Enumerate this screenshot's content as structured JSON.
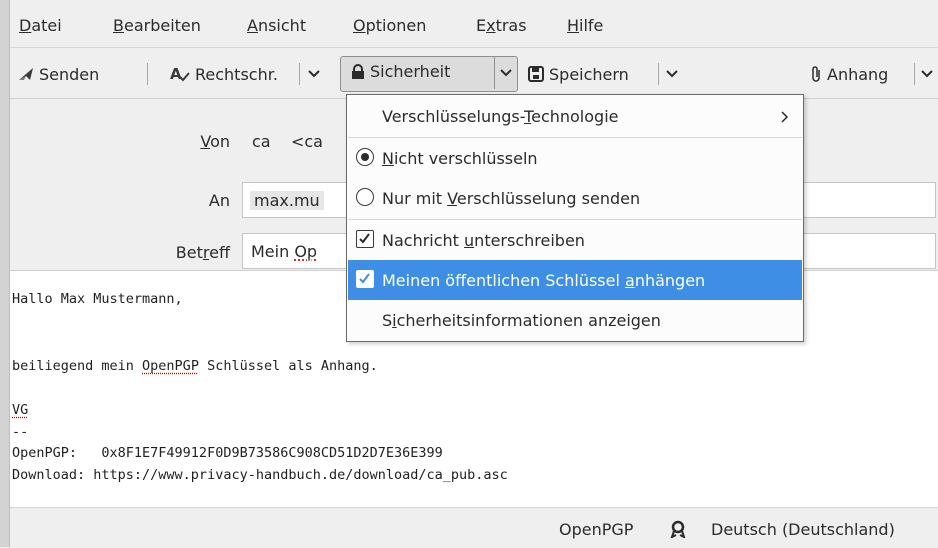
{
  "menubar": {
    "items": [
      {
        "pre": "",
        "u": "D",
        "post": "atei"
      },
      {
        "pre": "",
        "u": "B",
        "post": "earbeiten"
      },
      {
        "pre": "",
        "u": "A",
        "post": "nsicht"
      },
      {
        "pre": "",
        "u": "O",
        "post": "ptionen"
      },
      {
        "pre": "E",
        "u": "x",
        "post": "tras"
      },
      {
        "pre": "",
        "u": "H",
        "post": "ilfe"
      }
    ]
  },
  "toolbar": {
    "send_label": "Senden",
    "spell_label": "Rechtschr.",
    "security_label": "Sicherheit",
    "save_label": "Speichern",
    "attach_label": "Anhang"
  },
  "header": {
    "from_label": {
      "pre": "",
      "u": "V",
      "post": "on"
    },
    "from_value": "ca    <ca",
    "to_label": "An",
    "to_value": "max.mu",
    "subject_label": {
      "pre": "Bet",
      "u": "r",
      "post": "eff"
    },
    "subject_value_pre": "Mein ",
    "subject_value_spell": "Op"
  },
  "body": {
    "line1": "Hallo Max Mustermann,",
    "line2_pre": "beiliegend mein ",
    "line2_spell": "OpenPGP",
    "line2_post": " Schlüssel als Anhang.",
    "line3": "VG",
    "line4": "--",
    "line5": "OpenPGP:   0x8F1E7F49912F0D9B73586C908CD51D2D7E36E399",
    "line6": "Download: https://www.privacy-handbuch.de/download/ca_pub.asc"
  },
  "statusbar": {
    "openpgp": "OpenPGP",
    "language": "Deutsch (Deutschland)"
  },
  "dropdown": {
    "encryption_tech": {
      "pre": "Verschlüsselungs-",
      "u": "T",
      "post": "echnologie"
    },
    "no_encrypt": {
      "pre": "",
      "u": "N",
      "post": "icht verschlüsseln"
    },
    "only_encrypt": {
      "pre": "Nur mit ",
      "u": "V",
      "post": "erschlüsselung senden"
    },
    "sign": {
      "pre": "Nachricht ",
      "u": "u",
      "post": "nterschreiben"
    },
    "attach_key": {
      "pre": "Meinen öffentlichen Schlüssel ",
      "u": "a",
      "post": "nhängen"
    },
    "show_info": {
      "pre": "S",
      "u": "i",
      "post": "cherheitsinformationen anzeigen"
    },
    "state": {
      "no_encrypt": "selected",
      "sign": "checked",
      "attach_key": "checked"
    }
  },
  "colors": {
    "highlight": "#3d8ee4"
  }
}
